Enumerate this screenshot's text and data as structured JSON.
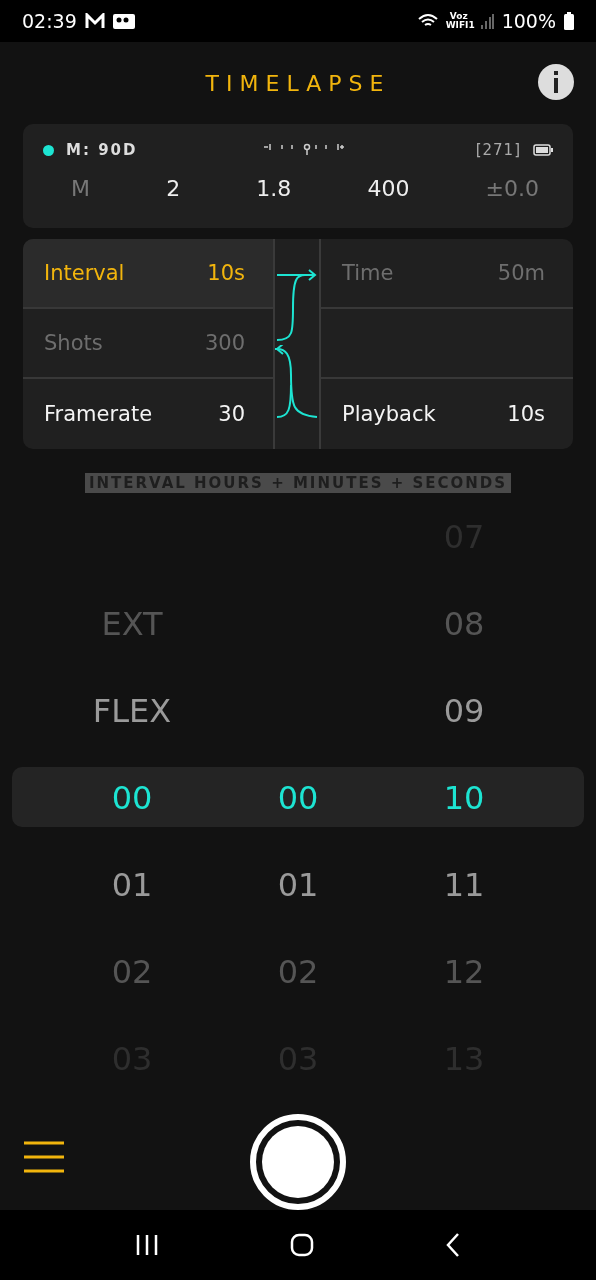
{
  "status_bar": {
    "time": "02:39",
    "network": "Voz WIFI1",
    "battery": "100%"
  },
  "header": {
    "title": "TIMELAPSE"
  },
  "camera": {
    "connected": true,
    "model": "M: 90D",
    "shots_left": "[271]",
    "exposure": [
      {
        "value": "M",
        "dimmed": true
      },
      {
        "value": "2",
        "dimmed": false
      },
      {
        "value": "1.8",
        "dimmed": false
      },
      {
        "value": "400",
        "dimmed": false
      },
      {
        "value": "±0.0",
        "dimmed": true
      }
    ]
  },
  "settings": {
    "left": [
      {
        "label": "Interval",
        "value": "10s",
        "selected": true,
        "dimmed": false
      },
      {
        "label": "Shots",
        "value": "300",
        "selected": false,
        "dimmed": true
      },
      {
        "label": "Framerate",
        "value": "30",
        "selected": false,
        "dimmed": false
      }
    ],
    "right": [
      {
        "label": "Time",
        "value": "50m",
        "selected": false,
        "dimmed": true
      },
      {
        "label": "Playback",
        "value": "10s",
        "selected": false,
        "dimmed": false
      }
    ]
  },
  "picker": {
    "caption": "INTERVAL HOURS + MINUTES + SECONDS",
    "columns": [
      {
        "items": [
          {
            "text": "EXT",
            "selected": false
          },
          {
            "text": "FLEX",
            "selected": false
          },
          {
            "text": "00",
            "selected": true
          },
          {
            "text": "01",
            "selected": false
          },
          {
            "text": "02",
            "selected": false
          },
          {
            "text": "03",
            "selected": false
          }
        ]
      },
      {
        "items": [
          {
            "text": "00",
            "selected": true
          },
          {
            "text": "01",
            "selected": false
          },
          {
            "text": "02",
            "selected": false
          },
          {
            "text": "03",
            "selected": false
          }
        ]
      },
      {
        "items": [
          {
            "text": "07",
            "selected": false
          },
          {
            "text": "08",
            "selected": false
          },
          {
            "text": "09",
            "selected": false
          },
          {
            "text": "10",
            "selected": true
          },
          {
            "text": "11",
            "selected": false
          },
          {
            "text": "12",
            "selected": false
          },
          {
            "text": "13",
            "selected": false
          }
        ]
      }
    ]
  }
}
